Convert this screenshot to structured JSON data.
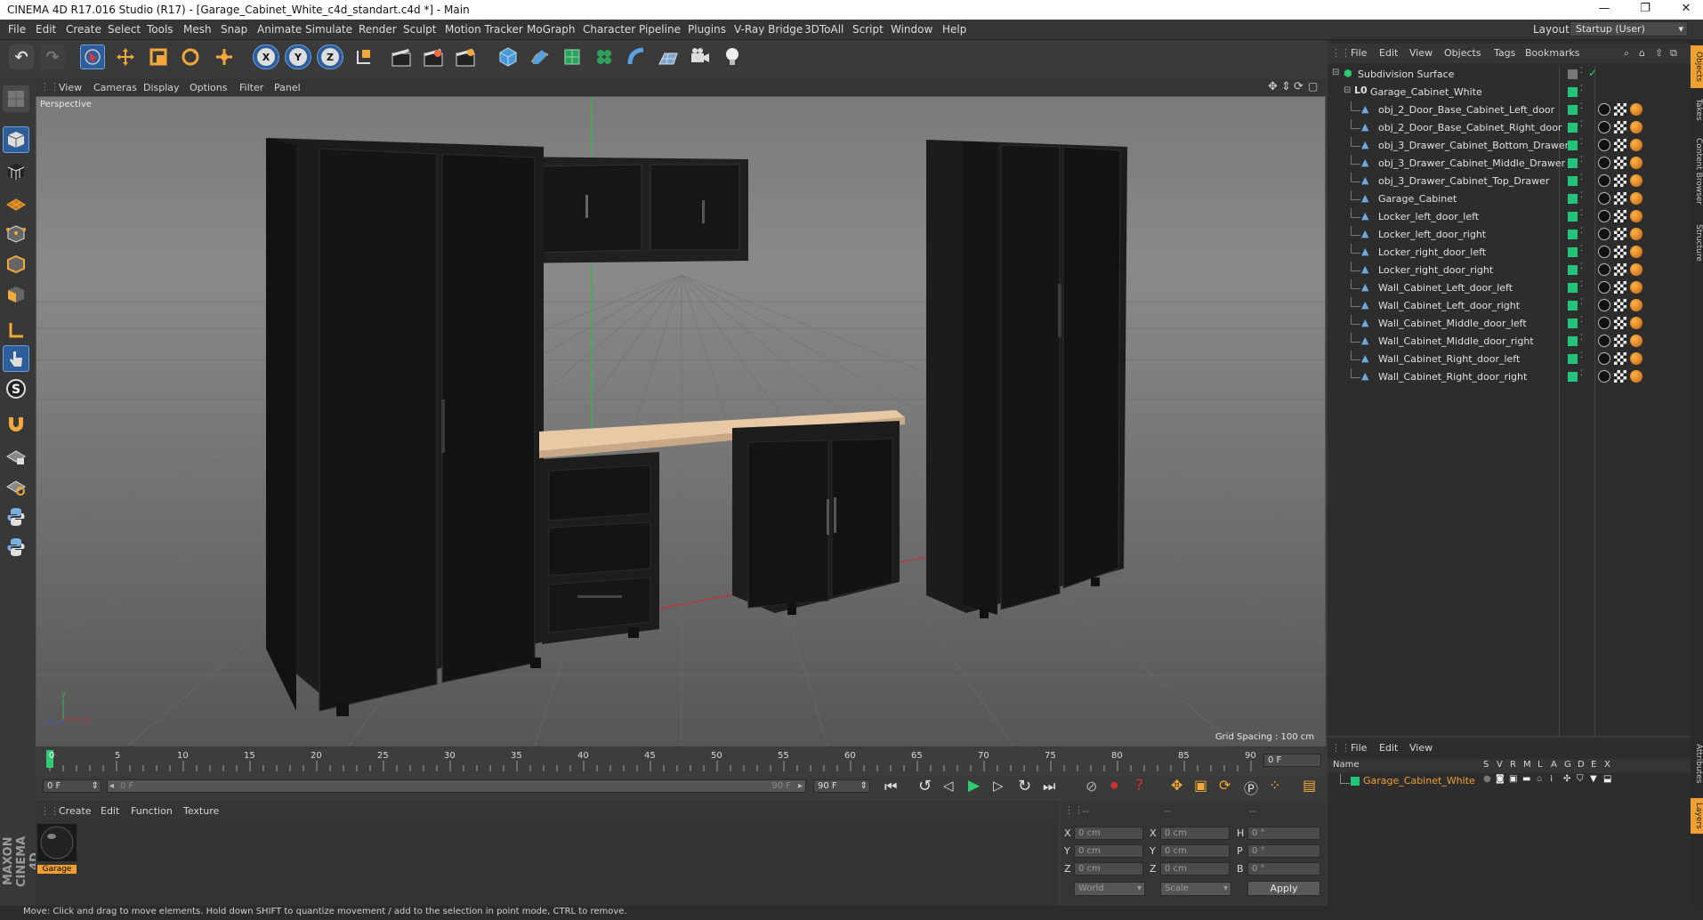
{
  "window": {
    "title": "CINEMA 4D R17.016 Studio (R17) - [Garage_Cabinet_White_c4d_standart.c4d *] - Main",
    "minimize": "—",
    "maximize": "❐",
    "close": "✕"
  },
  "menubar": {
    "items": [
      "File",
      "Edit",
      "Create",
      "Select",
      "Tools",
      "Mesh",
      "Snap",
      "Animate",
      "Simulate",
      "Render",
      "Sculpt",
      "Motion Tracker",
      "MoGraph",
      "Character",
      "Pipeline",
      "Plugins",
      "V-Ray Bridge",
      "3DToAll",
      "Script",
      "Window",
      "Help"
    ],
    "layout_label": "Layout:",
    "layout_value": "Startup (User)"
  },
  "toolbar": {
    "axis_x": "X",
    "axis_y": "Y",
    "axis_z": "Z"
  },
  "viewport": {
    "menu": [
      "View",
      "Cameras",
      "Display",
      "Options",
      "Filter",
      "Panel"
    ],
    "label": "Perspective",
    "grid_spacing": "Grid Spacing : 100 cm"
  },
  "timeline": {
    "ticks": [
      "0",
      "5",
      "10",
      "15",
      "20",
      "25",
      "30",
      "35",
      "40",
      "45",
      "50",
      "55",
      "60",
      "65",
      "70",
      "75",
      "80",
      "85",
      "90"
    ],
    "current_frame": "0 F",
    "start_field": "0 F",
    "range_start": "0 F",
    "range_end": "90 F",
    "end_field": "90 F"
  },
  "materials": {
    "menu": [
      "Create",
      "Edit",
      "Function",
      "Texture"
    ],
    "items": [
      {
        "name": "Garage"
      }
    ]
  },
  "coords": {
    "header": [
      "--",
      "--",
      "--"
    ],
    "rows": [
      {
        "a": "X",
        "av": "0 cm",
        "b": "X",
        "bv": "0 cm",
        "c": "H",
        "cv": "0 °"
      },
      {
        "a": "Y",
        "av": "0 cm",
        "b": "Y",
        "bv": "0 cm",
        "c": "P",
        "cv": "0 °"
      },
      {
        "a": "Z",
        "av": "0 cm",
        "b": "Z",
        "bv": "0 cm",
        "c": "B",
        "cv": "0 °"
      }
    ],
    "space": "World",
    "mode": "Scale",
    "apply": "Apply"
  },
  "objects": {
    "menu": [
      "File",
      "Edit",
      "View",
      "Objects",
      "Tags",
      "Bookmarks"
    ],
    "root": "Subdivision Surface",
    "group": "Garage_Cabinet_White",
    "children": [
      "obj_2_Door_Base_Cabinet_Left_door",
      "obj_2_Door_Base_Cabinet_Right_door",
      "obj_3_Drawer_Cabinet_Bottom_Drawer",
      "obj_3_Drawer_Cabinet_Middle_Drawer",
      "obj_3_Drawer_Cabinet_Top_Drawer",
      "Garage_Cabinet",
      "Locker_left_door_left",
      "Locker_left_door_right",
      "Locker_right_door_left",
      "Locker_right_door_right",
      "Wall_Cabinet_Left_door_left",
      "Wall_Cabinet_Left_door_right",
      "Wall_Cabinet_Middle_door_left",
      "Wall_Cabinet_Middle_door_right",
      "Wall_Cabinet_Right_door_left",
      "Wall_Cabinet_Right_door_right"
    ]
  },
  "layers": {
    "menu": [
      "File",
      "Edit",
      "View"
    ],
    "name_header": "Name",
    "columns": [
      "S",
      "V",
      "R",
      "M",
      "L",
      "A",
      "G",
      "D",
      "E",
      "X"
    ],
    "rows": [
      "Garage_Cabinet_White"
    ]
  },
  "right_tabs": [
    "Objects",
    "Takes",
    "Content Browser",
    "Structure",
    "Attributes",
    "Layers"
  ],
  "brand": "MAXON CINEMA 4D",
  "status": "Move: Click and drag to move elements. Hold down SHIFT to quantize movement / add to the selection in point mode, CTRL to remove.",
  "colors": {
    "accent": "#f0a030",
    "green": "#22c47a",
    "selection": "#ff8800"
  }
}
